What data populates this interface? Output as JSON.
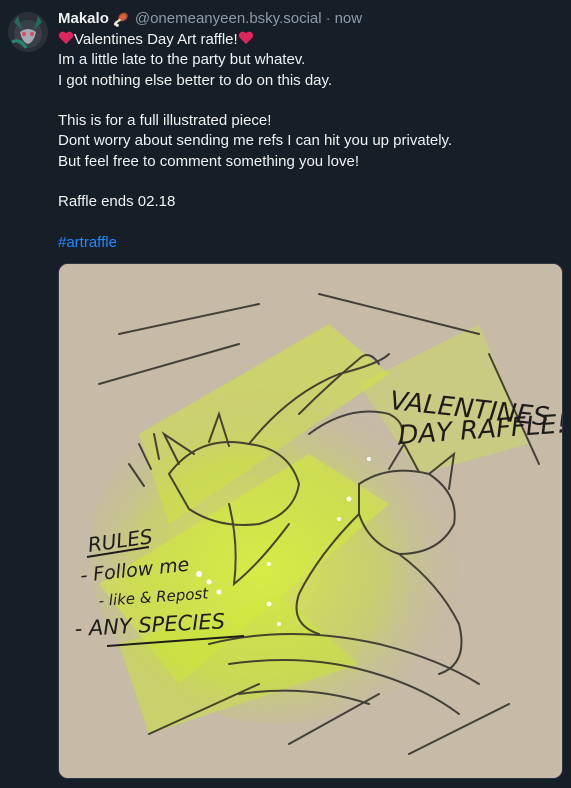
{
  "post": {
    "author": {
      "display_name": "Makalo",
      "name_emoji": "meat-on-bone-icon",
      "handle": "@onemeanyeen.bsky.social",
      "separator": "·",
      "timestamp": "now"
    },
    "lines": [
      "Valentines Day Art raffle!",
      "Im a little late to the party but whatev.",
      "I got nothing else better to do on this day.",
      "",
      "This is for a full illustrated piece!",
      "Dont worry about sending me refs I can hit you up privately.",
      "But feel free to comment something you love!",
      "",
      "Raffle ends 02.18",
      ""
    ],
    "hashtag": "#artraffle",
    "colors": {
      "background": "#161e27",
      "text": "#f1f3f5",
      "muted": "#8d9aab",
      "link": "#208bfe",
      "heart": "#e0245e"
    },
    "image": {
      "handwritten_text": [
        "VALENTINES",
        "DAY RAFFLE!",
        "RULES",
        "- Follow me",
        "- like & Repost",
        "- ANY SPECIES"
      ]
    }
  }
}
